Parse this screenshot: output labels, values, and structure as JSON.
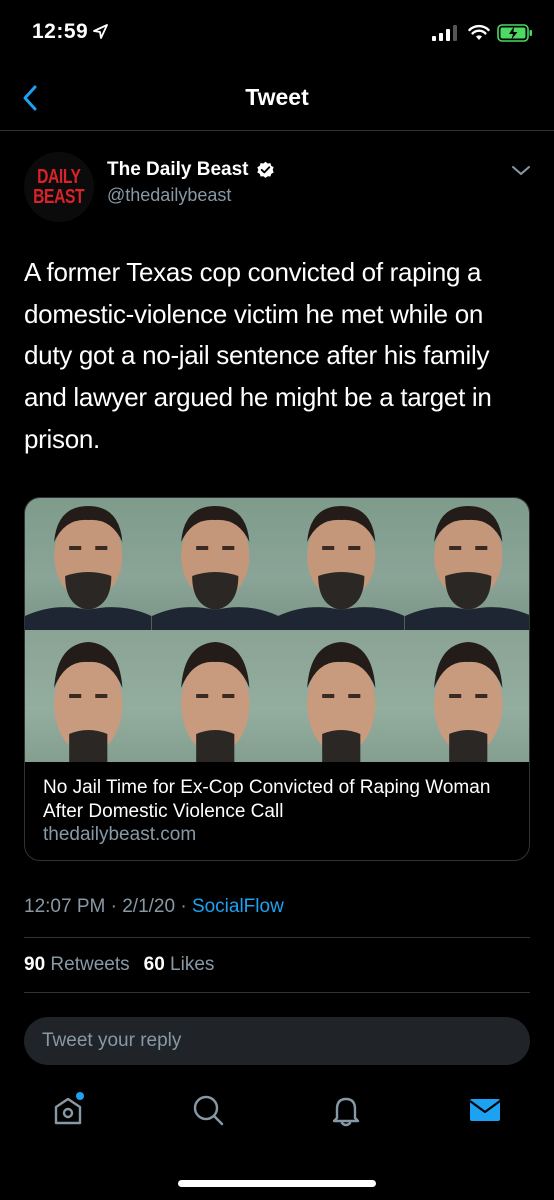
{
  "status_bar": {
    "time": "12:59"
  },
  "header": {
    "title": "Tweet"
  },
  "author": {
    "avatar_text_line1": "DAILY",
    "avatar_text_line2": "BEAST",
    "name": "The Daily Beast",
    "handle": "@thedailybeast"
  },
  "tweet": {
    "text": "A former Texas cop convicted of raping a domestic-violence victim he met while on duty got a no-jail sentence after his family and lawyer argued he might be a target in prison."
  },
  "card": {
    "title": "No Jail Time for Ex-Cop Convicted of Raping Woman After Domestic Violence Call",
    "domain": "thedailybeast.com"
  },
  "meta": {
    "time": "12:07 PM",
    "date": "2/1/20",
    "source": "SocialFlow",
    "separator": "·"
  },
  "stats": {
    "retweets_count": "90",
    "retweets_label": "Retweets",
    "likes_count": "60",
    "likes_label": "Likes"
  },
  "reply": {
    "placeholder": "Tweet your reply"
  },
  "tabs": [
    {
      "name": "home",
      "active": false,
      "icon": "home-icon"
    },
    {
      "name": "search",
      "active": false,
      "icon": "search-icon"
    },
    {
      "name": "notifications",
      "active": false,
      "icon": "bell-icon"
    },
    {
      "name": "messages",
      "active": true,
      "icon": "mail-icon"
    }
  ],
  "colors": {
    "accent": "#1da1f2",
    "muted": "#8899a6",
    "brand_red": "#d8232a",
    "background": "#000000"
  }
}
